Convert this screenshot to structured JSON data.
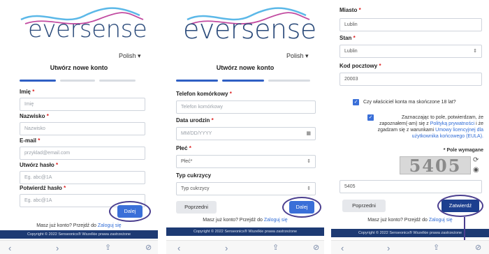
{
  "brand": {
    "logo_text": "eversense",
    "logo_superscript": "®"
  },
  "language": "Polish",
  "form_title": "Utwórz nowe konto",
  "step1": {
    "fields": [
      {
        "label": "Imię",
        "placeholder": "Imię"
      },
      {
        "label": "Nazwisko",
        "placeholder": "Nazwisko"
      },
      {
        "label": "E-mail",
        "placeholder": "przyklad@email.com"
      },
      {
        "label": "Utwórz hasło",
        "placeholder": "Eg. abc@1A"
      },
      {
        "label": "Potwierdź hasło",
        "placeholder": "Eg. abc@1A"
      }
    ],
    "next_button": "Dalej"
  },
  "step2": {
    "phone_label": "Telefon komórkowy",
    "phone_placeholder": "Telefon komórkowy",
    "dob_label": "Data urodzin",
    "dob_placeholder": "MM/DD/YYYY",
    "gender_label": "Płeć",
    "gender_value": "Płeć*",
    "diabetes_label": "Typ cukrzycy",
    "diabetes_value": "Typ cukrzycy",
    "prev_button": "Poprzedni",
    "next_button": "Dalej"
  },
  "step3": {
    "city_label": "Miasto",
    "city_value": "Lublin",
    "state_label": "Stan",
    "state_value": "Lublin",
    "zip_label": "Kod pocztowy",
    "zip_value": "20003",
    "age_question": "Czy właściciel konta ma skończone 18 lat?",
    "consent_part1": "Zaznaczając to pole, potwierdzam, że",
    "consent_part2": "zapoznałem(-am) się z",
    "consent_link1": "Polityką prywatności",
    "consent_part3": "i że",
    "consent_part4": "zgadzam się z warunkami",
    "consent_link2": "Umowy licencyjnej dla",
    "consent_link2b": "użytkownika końcowego (EULA).",
    "required_note": "* Pole wymagane",
    "captcha_text": "5405",
    "captcha_input_value": "5405",
    "prev_button": "Poprzedni",
    "submit_button": "Zatwierdź"
  },
  "login_hint": {
    "text": "Masz już konto? Przejdź do",
    "link": "Zaloguj się"
  },
  "copyright": "Copyright © 2022 Senseonics® Wszelkie prawa zastrzeżone",
  "nav_icons": [
    "back-icon",
    "forward-icon",
    "share-icon",
    "compass-icon"
  ],
  "colors": {
    "primary": "#3a6fd8",
    "primary_dark": "#1c3f8f",
    "footer": "#1d3a73",
    "annotation": "#4b3f8f",
    "required": "#d22222"
  }
}
